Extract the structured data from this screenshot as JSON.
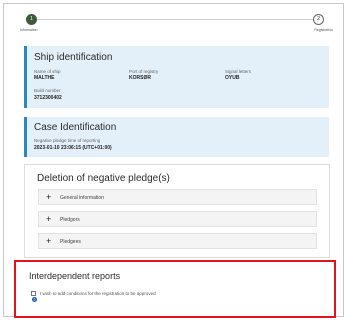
{
  "stepper": {
    "step1_number": "1",
    "step1_label": "Information",
    "step2_number": "2",
    "step2_label": "Registration"
  },
  "ship": {
    "title": "Ship identification",
    "name_label": "Name of ship",
    "name_value": "MALTHE",
    "port_label": "Port of registry",
    "port_value": "KORSØR",
    "signal_label": "Signal letters",
    "signal_value": "OYUB",
    "build_label": "Build number",
    "build_value": "3712300402"
  },
  "case": {
    "title": "Case Identification",
    "time_label": "Negative pledge time of reporting",
    "time_value": "2023-01-10 23:06:15 (UTC+01:00)"
  },
  "deletion": {
    "title": "Deletion of negative pledge(s)",
    "items": [
      {
        "label": "General information"
      },
      {
        "label": "Pledgors"
      },
      {
        "label": "Pledgees"
      }
    ]
  },
  "interdependent": {
    "title": "Interdependent reports",
    "checkbox_label": "I wish to add conditions for the registration to be approved",
    "help_glyph": "?"
  },
  "colors": {
    "accent_blue": "#2e86c1",
    "highlight_red": "#e0141d",
    "step_active": "#3c5a3c"
  }
}
